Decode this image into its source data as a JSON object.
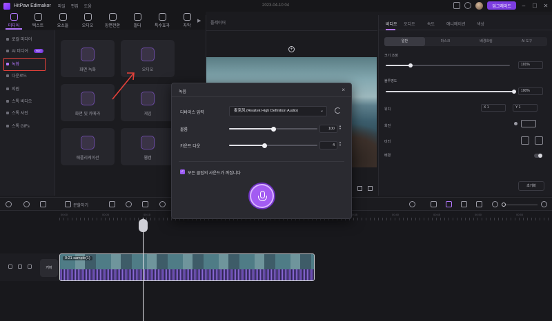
{
  "app": {
    "name": "HitPaw Edimakor",
    "menu": [
      "파일",
      "편집",
      "도움"
    ],
    "date": "2023-04-10 04",
    "upgrade_label": "업그레이드"
  },
  "toolbar": {
    "tools": [
      {
        "label": "미디어",
        "icon": "media-icon"
      },
      {
        "label": "텍스트",
        "icon": "text-icon"
      },
      {
        "label": "요소들",
        "icon": "elements-icon"
      },
      {
        "label": "오디오",
        "icon": "audio-icon"
      },
      {
        "label": "장면전환",
        "icon": "transition-icon"
      },
      {
        "label": "필터",
        "icon": "filter-icon"
      },
      {
        "label": "특수효과",
        "icon": "effects-icon"
      },
      {
        "label": "자막",
        "icon": "subtitle-icon"
      }
    ],
    "active_index": 0
  },
  "sidebar": {
    "items": [
      {
        "label": "로컬 미디어"
      },
      {
        "label": "AI 미디어",
        "badge": "HOT"
      },
      {
        "label": "녹화"
      },
      {
        "label": "다운로드"
      },
      {
        "label": "지원"
      },
      {
        "label": "스톡 비디오"
      },
      {
        "label": "스톡 사진"
      },
      {
        "label": "스톡 GIFs"
      }
    ],
    "active_index": 2
  },
  "media_grid": {
    "cards": [
      {
        "label": "화면 녹화",
        "icon": "screen-record-icon"
      },
      {
        "label": "오디오",
        "icon": "microphone-icon"
      },
      {
        "label": "화면 및 카메라",
        "icon": "screen-camera-icon"
      },
      {
        "label": "게임",
        "icon": "gamepad-icon"
      },
      {
        "label": "애플리케이션",
        "icon": "application-icon"
      },
      {
        "label": "웹캠",
        "icon": "webcam-icon"
      }
    ]
  },
  "player": {
    "title": "플레이어"
  },
  "properties": {
    "tabs": [
      "비디오",
      "오디오",
      "속도",
      "애니메이션",
      "색상"
    ],
    "active_tab": 0,
    "subtabs": [
      "일반",
      "마스크",
      "배경흐림",
      "AI 도구"
    ],
    "active_subtab": 0,
    "scale_label": "크기 조정",
    "scale_value": "101%",
    "scale_level": 0.2,
    "opacity_label": "불투명도",
    "opacity_value": "100%",
    "opacity_level": 1.0,
    "position_label": "위치",
    "position_x": "X  1",
    "position_y": "Y  1",
    "rotate_label": "회전",
    "flip_label": "미러",
    "bg_label": "배경",
    "reset_label": "초기화"
  },
  "timeline_toolbar": {
    "split_label": "분할하기"
  },
  "timeline": {
    "ruler_labels": [
      "00:00",
      "00:05",
      "00:10",
      "00:15",
      "00:20",
      "00:25",
      "00:30",
      "00:35",
      "00:40",
      "00:45",
      "00:50",
      "00:55"
    ],
    "track_cover_label": "커버",
    "clip_label": "0:21  sample(1)"
  },
  "dialog": {
    "title": "녹음",
    "close": "×",
    "device_label": "디바이스 입력",
    "device_value": "麦克风 (Realtek High Definition Audio)",
    "volume_label": "볼륨",
    "volume_value": "100",
    "volume_level": 0.5,
    "countdown_label": "카운트 다운",
    "countdown_value": "4",
    "countdown_level": 0.4,
    "mute_label": "모든 클립의 사운드가 꺼집니다",
    "mute_checked": true,
    "accent": "#a35cf2"
  }
}
